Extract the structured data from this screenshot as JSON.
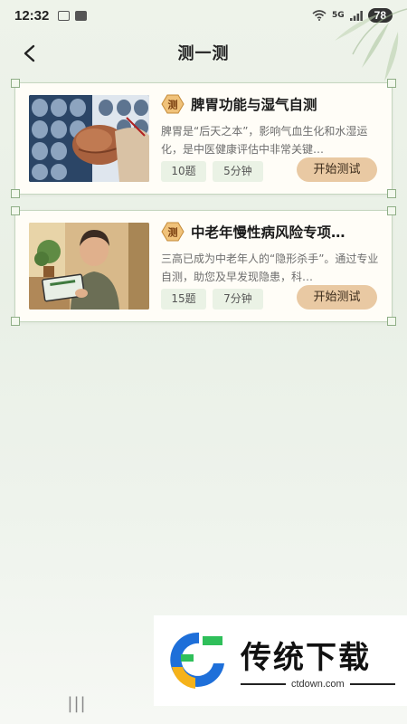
{
  "status_bar": {
    "time": "12:32",
    "signal": "5G",
    "battery": "78"
  },
  "header": {
    "title": "测一测"
  },
  "cards": [
    {
      "badge": "测",
      "title": "脾胃功能与湿气自测",
      "description": "脾胃是“后天之本”，影响气血生化和水湿运化，是中医健康评估中非常关键…",
      "questions": "10题",
      "duration": "5分钟",
      "button": "开始测试",
      "image": "brain-scan-illustration"
    },
    {
      "badge": "测",
      "title": "中老年慢性病风险专项…",
      "description": "三高已成为中老年人的“隐形杀手”。通过专业自测，助您及早发现隐患，科…",
      "questions": "15题",
      "duration": "7分钟",
      "button": "开始测试",
      "image": "elderly-woman-tablet-illustration"
    }
  ],
  "watermark": {
    "title": "传统下载",
    "url": "ctdown.com"
  },
  "nav": {
    "recent": "|||"
  },
  "colors": {
    "accent_button": "#e9c9a3",
    "tag_bg": "#eaf2e5",
    "card_border": "#c5d6bf"
  }
}
